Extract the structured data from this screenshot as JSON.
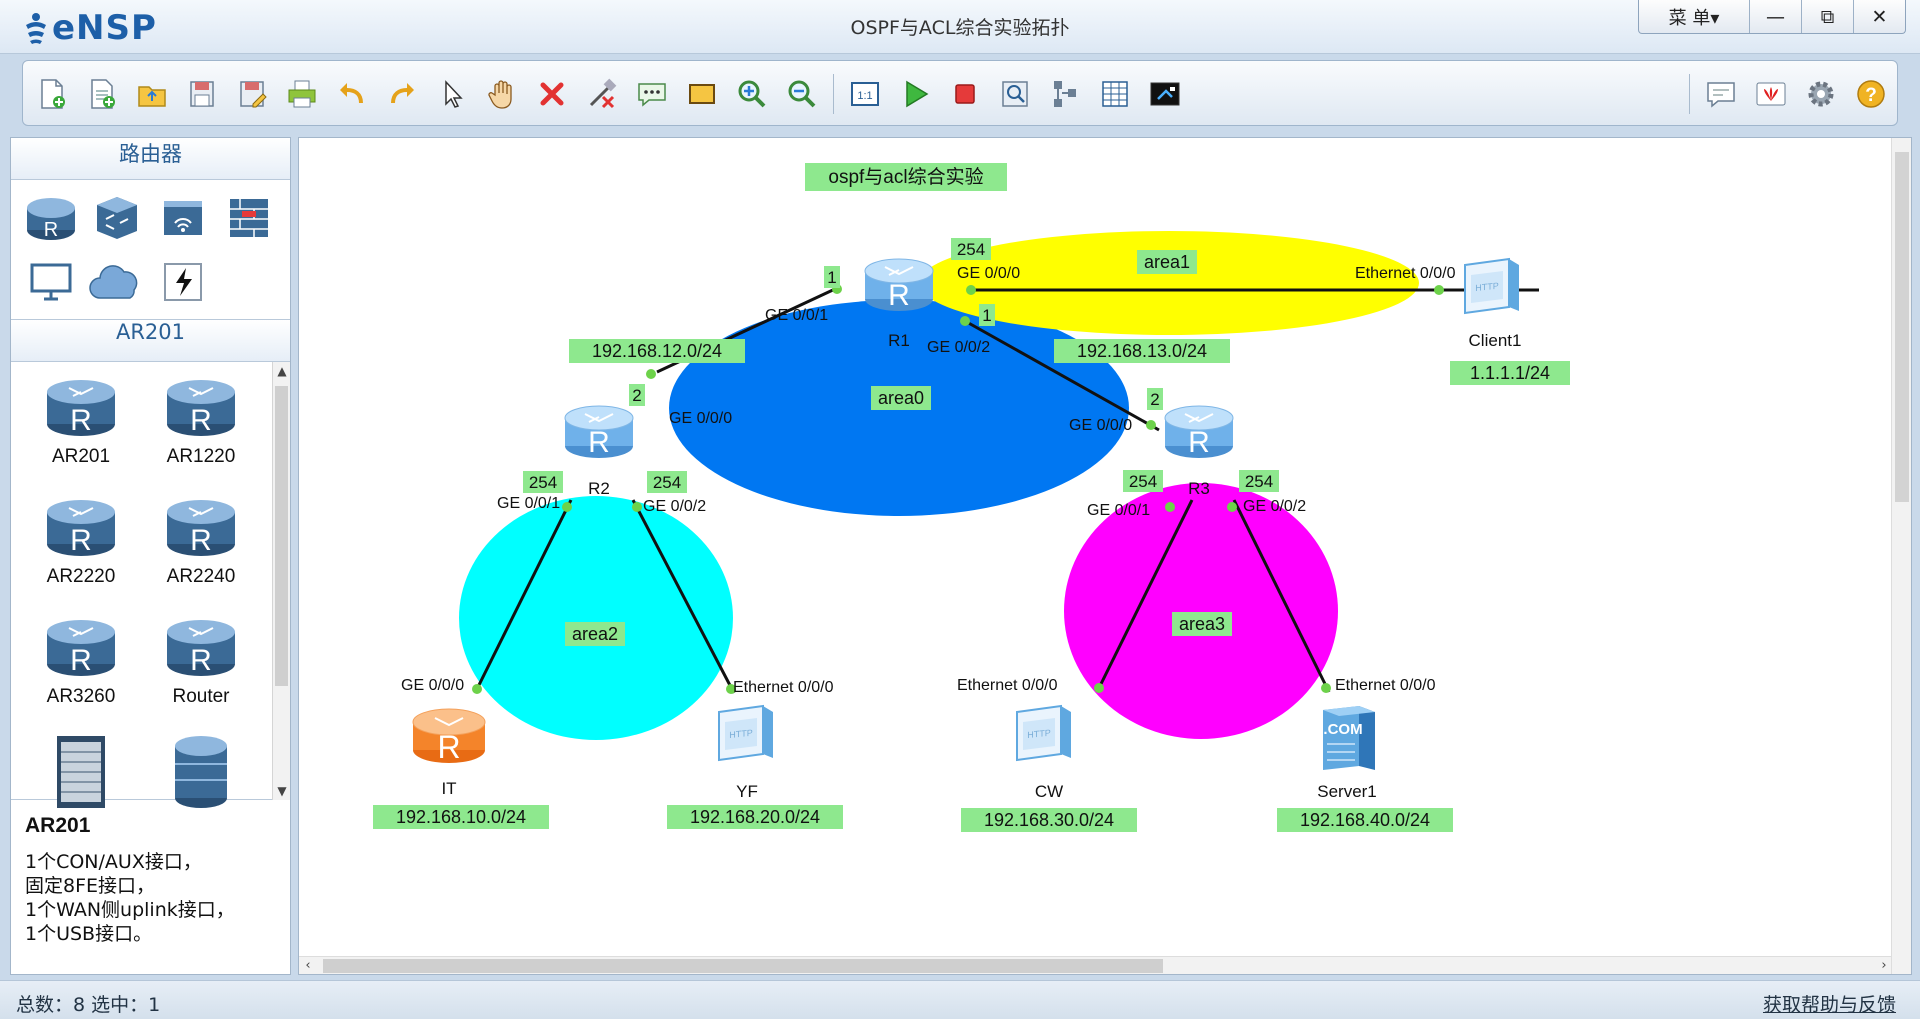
{
  "app": {
    "name": "eNSP",
    "window_title": "OSPF与ACL综合实验拓扑"
  },
  "window_controls": {
    "menu": "菜 单▾",
    "minimize": "—",
    "maximize": "⧉",
    "close": "✕"
  },
  "toolbar": {
    "left": [
      {
        "name": "new-topology",
        "icon": "new-file-icon"
      },
      {
        "name": "new-example",
        "icon": "new-example-icon"
      },
      {
        "name": "open",
        "icon": "open-folder-icon"
      },
      {
        "name": "save",
        "icon": "save-icon"
      },
      {
        "name": "save-as",
        "icon": "save-as-icon"
      },
      {
        "name": "print",
        "icon": "print-icon"
      },
      {
        "name": "undo",
        "icon": "undo-icon"
      },
      {
        "name": "redo",
        "icon": "redo-icon"
      },
      {
        "name": "select",
        "icon": "pointer-icon"
      },
      {
        "name": "pan",
        "icon": "hand-icon"
      },
      {
        "name": "delete",
        "icon": "delete-icon"
      },
      {
        "name": "delete-link",
        "icon": "delete-link-icon"
      },
      {
        "name": "text",
        "icon": "text-annotation-icon"
      },
      {
        "name": "shape",
        "icon": "rectangle-icon"
      },
      {
        "name": "zoom-in",
        "icon": "zoom-in-icon"
      },
      {
        "name": "zoom-out",
        "icon": "zoom-out-icon"
      }
    ],
    "middle": [
      {
        "name": "fit",
        "icon": "fit-window-icon"
      },
      {
        "name": "start",
        "icon": "play-icon"
      },
      {
        "name": "stop",
        "icon": "stop-icon"
      },
      {
        "name": "capture",
        "icon": "capture-icon"
      },
      {
        "name": "topology",
        "icon": "topology-icon"
      },
      {
        "name": "grid",
        "icon": "grid-icon"
      },
      {
        "name": "console",
        "icon": "console-icon"
      }
    ],
    "right": [
      {
        "name": "chat",
        "icon": "chat-icon"
      },
      {
        "name": "huawei",
        "icon": "huawei-logo-icon"
      },
      {
        "name": "settings",
        "icon": "gear-icon"
      },
      {
        "name": "help",
        "icon": "help-icon"
      }
    ]
  },
  "left_panel": {
    "category_title": "路由器",
    "categories": [
      "router-icon",
      "switch-icon",
      "wireless-icon",
      "firewall-icon",
      "pc-icon",
      "cloud-icon",
      "other-device-icon"
    ],
    "device_group_title": "AR201",
    "devices": [
      "AR201",
      "AR1220",
      "AR2220",
      "AR2240",
      "AR3260",
      "Router",
      "",
      ""
    ],
    "description": {
      "title": "AR201",
      "lines": [
        "1个CON/AUX接口，",
        "固定8FE接口，",
        "1个WAN侧uplink接口，",
        "1个USB接口。"
      ]
    }
  },
  "topology": {
    "title": "ospf与acl综合实验",
    "areas": [
      {
        "label": "area0",
        "color": "#0077f2"
      },
      {
        "label": "area1",
        "color": "#ffff00"
      },
      {
        "label": "area2",
        "color": "#00ffff"
      },
      {
        "label": "area3",
        "color": "#ff00ff"
      }
    ],
    "nodes": {
      "R1": "R1",
      "R2": "R2",
      "R3": "R3",
      "Client1": "Client1",
      "IT": "IT",
      "YF": "YF",
      "CW": "CW",
      "Server1": "Server1"
    },
    "ports": {
      "r1_g000": "GE 0/0/0",
      "r1_g001": "GE 0/0/1",
      "r1_g002": "GE 0/0/2",
      "r2_g000": "GE 0/0/0",
      "r2_g001": "GE 0/0/1",
      "r2_g002": "GE 0/0/2",
      "r3_g000": "GE 0/0/0",
      "r3_g001": "GE 0/0/1",
      "r3_g002": "GE 0/0/2",
      "client_eth": "Ethernet 0/0/0",
      "it_g000": "GE 0/0/0",
      "yf_eth": "Ethernet 0/0/0",
      "cw_eth": "Ethernet 0/0/0",
      "srv_eth": "Ethernet 0/0/0"
    },
    "host_octets": {
      "r1_g000": "254",
      "r1_g001": "1",
      "r1_g002": "1",
      "r2_g000": "2",
      "r2_g001": "254",
      "r2_g002": "254",
      "r3_g000": "2",
      "r3_g001": "254",
      "r3_g002": "254"
    },
    "networks": {
      "r1_r2": "192.168.12.0/24",
      "r1_r3": "192.168.13.0/24",
      "client": "1.1.1.1/24",
      "it": "192.168.10.0/24",
      "yf": "192.168.20.0/24",
      "cw": "192.168.30.0/24",
      "server": "192.168.40.0/24"
    },
    "label_bg": "#8ee88e"
  },
  "statusbar": {
    "left": "总数：8  选中：1",
    "right": "获取帮助与反馈"
  }
}
